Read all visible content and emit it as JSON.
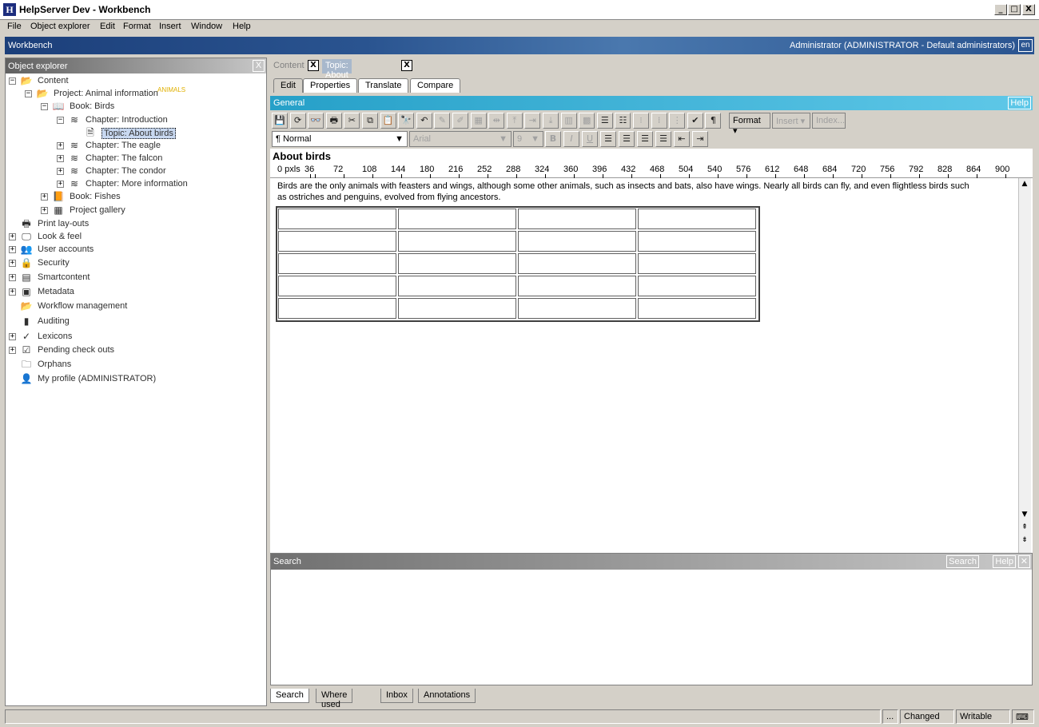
{
  "window": {
    "title": "HelpServer Dev - Workbench",
    "app_icon": "H",
    "min": "_",
    "max": "□",
    "close": "X"
  },
  "menu": [
    "File",
    "Object explorer",
    "Edit",
    "Format",
    "Insert",
    "Window",
    "Help"
  ],
  "workbench": {
    "label": "Workbench",
    "user": "Administrator (ADMINISTRATOR - Default administrators)",
    "lang": "en"
  },
  "explorer": {
    "title": "Object explorer",
    "close": "X",
    "nodes": [
      {
        "label": "Content",
        "icon": "folder-icon",
        "glyph": "📂",
        "expander": "minus"
      },
      {
        "label": "Project: Animal information",
        "icon": "project-icon",
        "glyph": "📂",
        "expander": "minus",
        "tag": "ANIMALS"
      },
      {
        "label": "Book: Birds",
        "icon": "book-icon",
        "glyph": "📖",
        "expander": "minus"
      },
      {
        "label": "Chapter: Introduction",
        "icon": "chapter-icon",
        "glyph": "≋",
        "expander": "minus"
      },
      {
        "label": "Topic: About birds",
        "icon": "topic-icon",
        "glyph": "🗎",
        "expander": "none",
        "selected": true
      },
      {
        "label": "Chapter: The eagle",
        "icon": "chapter-icon",
        "glyph": "≋",
        "expander": "plus"
      },
      {
        "label": "Chapter: The falcon",
        "icon": "chapter-icon",
        "glyph": "≋",
        "expander": "plus"
      },
      {
        "label": "Chapter: The condor",
        "icon": "chapter-icon",
        "glyph": "≋",
        "expander": "plus"
      },
      {
        "label": "Chapter: More information",
        "icon": "chapter-icon",
        "glyph": "≋",
        "expander": "plus"
      },
      {
        "label": "Book: Fishes",
        "icon": "book-icon",
        "glyph": "📙",
        "expander": "plus"
      },
      {
        "label": "Project gallery",
        "icon": "gallery-icon",
        "glyph": "▦",
        "expander": "plus"
      },
      {
        "label": "Print lay-outs",
        "icon": "printer-icon",
        "glyph": "🖶",
        "expander": "none"
      },
      {
        "label": "Look & feel",
        "icon": "monitor-icon",
        "glyph": "🖵",
        "expander": "plus"
      },
      {
        "label": "User accounts",
        "icon": "users-icon",
        "glyph": "👥",
        "expander": "plus"
      },
      {
        "label": "Security",
        "icon": "lock-icon",
        "glyph": "🔒",
        "expander": "plus"
      },
      {
        "label": "Smartcontent",
        "icon": "smartcontent-icon",
        "glyph": "▤",
        "expander": "plus"
      },
      {
        "label": "Metadata",
        "icon": "metadata-icon",
        "glyph": "▣",
        "expander": "plus"
      },
      {
        "label": "Workflow management",
        "icon": "workflow-icon",
        "glyph": "📂",
        "expander": "none"
      },
      {
        "label": "Auditing",
        "icon": "chart-icon",
        "glyph": "▮",
        "expander": "none"
      },
      {
        "label": "Lexicons",
        "icon": "spellcheck-icon",
        "glyph": "✓",
        "expander": "plus"
      },
      {
        "label": "Pending check outs",
        "icon": "checkout-icon",
        "glyph": "☑",
        "expander": "plus"
      },
      {
        "label": "Orphans",
        "icon": "orphans-icon",
        "glyph": "🗀",
        "expander": "none"
      },
      {
        "label": "My profile (ADMINISTRATOR)",
        "icon": "person-icon",
        "glyph": "👤",
        "expander": "none"
      }
    ]
  },
  "doc_tabs": [
    {
      "label": "Content",
      "active": false
    },
    {
      "label": "Topic: About birds",
      "active": true
    }
  ],
  "close_glyph": "X",
  "sub_tabs": [
    "Edit",
    "Properties",
    "Translate",
    "Compare"
  ],
  "general": {
    "title": "General",
    "help": "Help"
  },
  "toolbar": {
    "format": "Format",
    "insert": "Insert",
    "index": "Index...",
    "icons": [
      {
        "name": "save-icon",
        "g": "💾"
      },
      {
        "name": "refresh-icon",
        "g": "⟳"
      },
      {
        "name": "preview-icon",
        "g": "👓"
      },
      {
        "name": "print-icon",
        "g": "🖶"
      },
      {
        "name": "cut-icon",
        "g": "✂"
      },
      {
        "name": "copy-icon",
        "g": "⧉"
      },
      {
        "name": "paste-icon",
        "g": "📋"
      },
      {
        "name": "find-icon",
        "g": "🔭"
      },
      {
        "name": "undo-icon",
        "g": "↶"
      },
      {
        "name": "style-brush-icon",
        "g": "✎",
        "dis": true
      },
      {
        "name": "style-clear-icon",
        "g": "✐",
        "dis": true
      },
      {
        "name": "insert-table-icon",
        "g": "▦",
        "dis": true
      },
      {
        "name": "split-cells-icon",
        "g": "⇹",
        "dis": true
      },
      {
        "name": "insert-row-above-icon",
        "g": "⤒",
        "dis": true
      },
      {
        "name": "insert-col-icon",
        "g": "⇥",
        "dis": true
      },
      {
        "name": "delete-row-icon",
        "g": "⤓",
        "dis": true
      },
      {
        "name": "merge-cells-icon",
        "g": "▥",
        "dis": true
      },
      {
        "name": "table-props-icon",
        "g": "▩",
        "dis": true
      },
      {
        "name": "numbered-list-icon",
        "g": "☰"
      },
      {
        "name": "bullet-list-icon",
        "g": "☷"
      },
      {
        "name": "list-style-icon",
        "g": "⁝",
        "dis": true
      },
      {
        "name": "list-indent-icon",
        "g": "⁞",
        "dis": true
      },
      {
        "name": "list-outdent-icon",
        "g": "⋮",
        "dis": true
      },
      {
        "name": "spellcheck-icon",
        "g": "✔"
      },
      {
        "name": "pilcrow-icon",
        "g": "¶"
      }
    ]
  },
  "format_bar": {
    "paragraph": "Normal",
    "font": "Arial",
    "size": "9",
    "bold": "B",
    "italic": "I",
    "underline": "U",
    "icons": [
      {
        "name": "align-left-icon",
        "g": "☰"
      },
      {
        "name": "align-center-icon",
        "g": "☰"
      },
      {
        "name": "align-right-icon",
        "g": "☰"
      },
      {
        "name": "justify-icon",
        "g": "☰"
      },
      {
        "name": "outdent-icon",
        "g": "⇤"
      },
      {
        "name": "indent-icon",
        "g": "⇥"
      }
    ]
  },
  "document": {
    "title": "About birds",
    "body": "Birds are the only animals with feasters and wings, although some other animals, such as insects and bats, also have wings. Nearly all birds can fly, and even flightless birds such as ostriches and penguins, evolved from flying ancestors.",
    "table_rows": 5,
    "table_cols": 4
  },
  "ruler": [
    "0 pxls",
    "36",
    "72",
    "108",
    "144",
    "180",
    "216",
    "252",
    "288",
    "324",
    "360",
    "396",
    "432",
    "468",
    "504",
    "540",
    "576",
    "612",
    "648",
    "684",
    "720",
    "756",
    "792",
    "828",
    "864",
    "900"
  ],
  "search_panel": {
    "title": "Search",
    "search_btn": "Search",
    "help_btn": "Help"
  },
  "bottom_tabs": [
    "Search",
    "Where used",
    "Inbox",
    "Annotations"
  ],
  "status": {
    "more": "...",
    "changed": "Changed",
    "writable": "Writable"
  }
}
